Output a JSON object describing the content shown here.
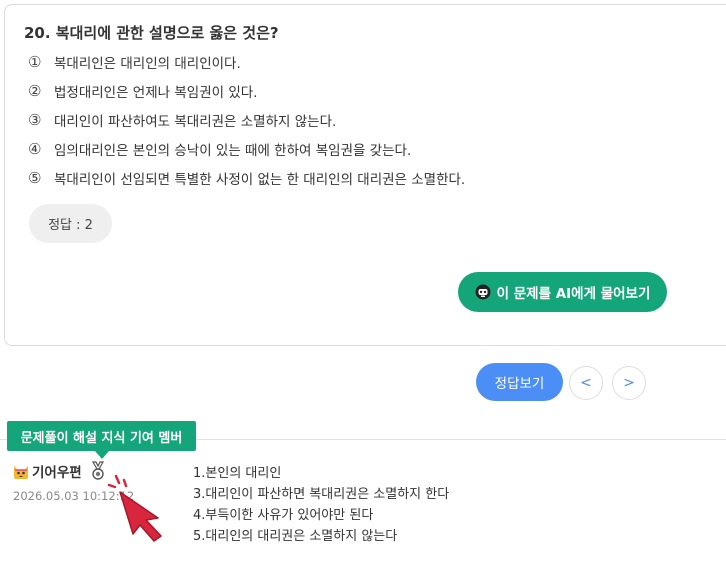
{
  "question": {
    "title": "20. 복대리에 관한 설명으로 옳은 것은?",
    "choices": [
      {
        "num": "①",
        "text": "복대리인은 대리인의 대리인이다."
      },
      {
        "num": "②",
        "text": "법정대리인은 언제나 복임권이 있다."
      },
      {
        "num": "③",
        "text": "대리인이 파산하여도 복대리권은 소멸하지 않는다."
      },
      {
        "num": "④",
        "text": "임의대리인은 본인의 승낙이 있는 때에 한하여 복임권을 갖는다."
      },
      {
        "num": "⑤",
        "text": "복대리인이 선임되면 특별한 사정이 없는 한 대리인의 대리권은 소멸한다."
      }
    ],
    "answer": "정답 : 2",
    "ai_button": "이 문제를 AI에게 물어보기",
    "ai_icon": "robot-icon"
  },
  "controls": {
    "show_answer": "정답보기",
    "prev": "<",
    "next": ">"
  },
  "comment": {
    "tooltip": "문제풀이 해설 지식 기여 멤버",
    "user": "기어우편",
    "user_icon": "cat-avatar-icon",
    "badge_icon": "medal-icon",
    "date": "2026.05.03 10:12:12",
    "lines": [
      "1.본인의 대리인",
      "3.대리인이 파산하면 복대리권은 소멸하지 한다",
      "4.부득이한 사유가 있어야만 된다",
      "5.대리인의 대리권은 소멸하지 않는다"
    ]
  },
  "colors": {
    "accent_green": "#14a67a",
    "accent_blue": "#4b8ef5",
    "pointer_red": "#d7263d"
  }
}
